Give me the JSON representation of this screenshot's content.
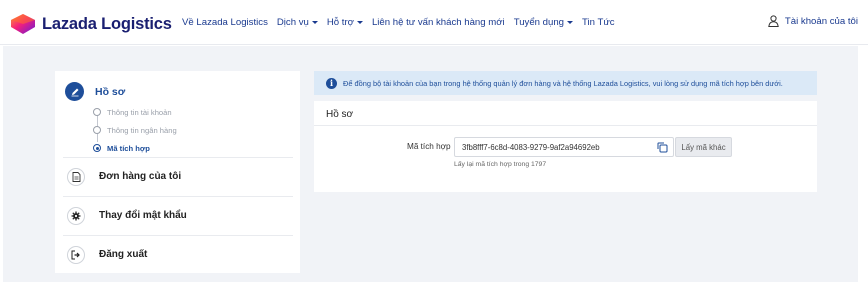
{
  "header": {
    "logo_text": "Lazada Logistics",
    "nav": [
      {
        "label": "Về Lazada Logistics",
        "has_caret": false
      },
      {
        "label": "Dịch vụ",
        "has_caret": true
      },
      {
        "label": "Hỗ trợ",
        "has_caret": true
      },
      {
        "label": "Liên hệ tư vấn khách hàng mới",
        "has_caret": false
      },
      {
        "label": "Tuyển dụng",
        "has_caret": true
      },
      {
        "label": "Tin Tức",
        "has_caret": false
      }
    ],
    "account_label": "Tài khoản của tôi",
    "account_icon": "user-icon"
  },
  "sidebar": {
    "profile": {
      "label": "Hồ sơ",
      "icon": "edit-icon"
    },
    "sub_items": [
      {
        "label": "Thông tin tài khoản",
        "active": false
      },
      {
        "label": "Thông tin ngân hàng",
        "active": false
      },
      {
        "label": "Mã tích hợp",
        "active": true
      }
    ],
    "rows": [
      {
        "label": "Đơn hàng của tôi",
        "icon": "document-icon"
      },
      {
        "label": "Thay đổi mật khẩu",
        "icon": "gear-icon"
      },
      {
        "label": "Đăng xuất",
        "icon": "logout-icon"
      }
    ]
  },
  "banner": {
    "icon": "info-icon",
    "text": "Để đồng bộ tài khoản của bạn trong hệ thống quản lý đơn hàng và hệ thống Lazada Logistics, vui lòng sử dụng mã tích hợp bên dưới."
  },
  "card": {
    "title": "Hồ sơ",
    "field_label": "Mã tích hợp",
    "code_value": "3fb8fff7-6c8d-4083-9279-9af2a94692eb",
    "other_code_button": "Lấy mã khác",
    "hint": "Lấy lại mã tích hợp trong 1797"
  },
  "colors": {
    "brand_blue": "#1e4e9a",
    "logo_navy": "#1a1f71",
    "banner_bg": "#dbe9f7",
    "page_bg": "#f1f3f7"
  }
}
